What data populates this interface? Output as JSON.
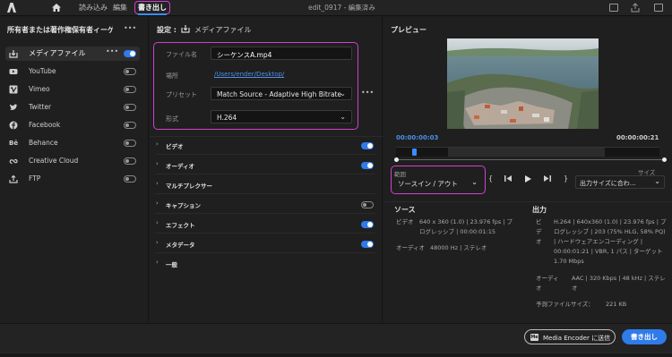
{
  "topbar": {
    "tabs": [
      "読み込み",
      "編集",
      "書き出し"
    ],
    "title": "edit_0917 - 編集済み"
  },
  "left": {
    "header": "所有者または著作権保有者ィーゲ…",
    "more": "•••",
    "destinations": [
      {
        "label": "メディアファイル",
        "icon": "export-icon",
        "on": true
      },
      {
        "label": "YouTube",
        "icon": "youtube-icon",
        "on": false
      },
      {
        "label": "Vimeo",
        "icon": "vimeo-icon",
        "on": false
      },
      {
        "label": "Twitter",
        "icon": "twitter-icon",
        "on": false
      },
      {
        "label": "Facebook",
        "icon": "facebook-icon",
        "on": false
      },
      {
        "label": "Behance",
        "icon": "behance-icon",
        "on": false
      },
      {
        "label": "Creative Cloud",
        "icon": "creative-cloud-icon",
        "on": false
      },
      {
        "label": "FTP",
        "icon": "ftp-icon",
        "on": false
      }
    ]
  },
  "settings": {
    "header": "設定 :",
    "header_target": "メディアファイル",
    "filename_label": "ファイル名",
    "filename": "シーケンスA.mp4",
    "location_label": "場所",
    "location": "/Users/ender/Desktop/",
    "preset_label": "プリセット",
    "preset": "Match Source - Adaptive High Bitrate",
    "format_label": "形式",
    "format": "H.264",
    "sections": [
      {
        "label": "ビデオ",
        "toggle": "on"
      },
      {
        "label": "オーディオ",
        "toggle": "on"
      },
      {
        "label": "マルチプレクサー",
        "toggle": "none"
      },
      {
        "label": "キャプション",
        "toggle": "off"
      },
      {
        "label": "エフェクト",
        "toggle": "on"
      },
      {
        "label": "メタデータ",
        "toggle": "on"
      },
      {
        "label": "一般",
        "toggle": "none"
      }
    ]
  },
  "preview": {
    "header": "プレビュー",
    "time_current": "00:00:00:03",
    "time_end": "00:00:00:21",
    "range_label": "範囲",
    "range_value": "ソースイン / アウト",
    "size_label": "サイズ",
    "size_value": "出力サイズに合わ…"
  },
  "source": {
    "header": "ソース",
    "video_label": "ビデオ",
    "video": "640 x 360 (1.0) | 23.976 fps | プログレッシブ | 00:00:01:15",
    "audio_label": "オーディオ",
    "audio": "48000 Hz | ステレオ"
  },
  "output": {
    "header": "出力",
    "video_label": "ビデオ",
    "video": "H.264 | 640x360 (1.0) | 23.976 fps | プログレッシブ | 203 (75% HLG, 58% PQ) | ハードウェアエンコーディング | 00:00:01:21 | VBR, 1 パス | ターゲット 1.70 Mbps",
    "audio_label": "オーディオ",
    "audio": "AAC | 320 Kbps | 48 kHz | ステレオ",
    "filesize_label": "予測ファイルサイズ：",
    "filesize": "221 KB"
  },
  "bottom": {
    "encoder_button": "Media Encoder に送信",
    "export_button": "書き出し"
  }
}
